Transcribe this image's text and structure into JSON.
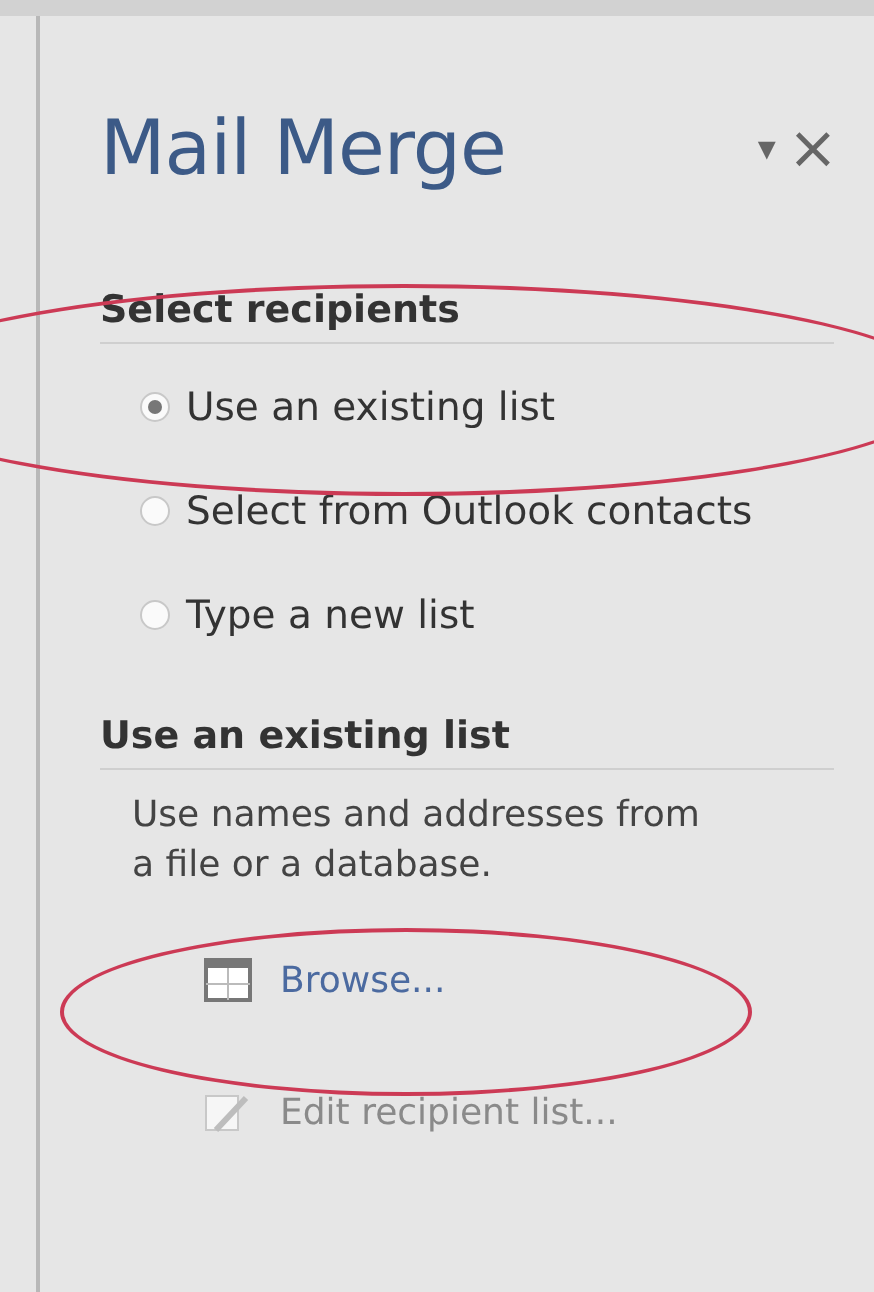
{
  "pane": {
    "title": "Mail Merge",
    "menu_glyph": "▾",
    "close_glyph": "×"
  },
  "select_recipients": {
    "heading": "Select recipients",
    "options": [
      {
        "label": "Use an existing list",
        "selected": true
      },
      {
        "label": "Select from Outlook contacts",
        "selected": false
      },
      {
        "label": "Type a new list",
        "selected": false
      }
    ]
  },
  "existing_list": {
    "heading": "Use an existing list",
    "description": "Use names and addresses from a file or a database.",
    "actions": [
      {
        "label": "Browse...",
        "kind": "browse",
        "disabled": false
      },
      {
        "label": "Edit recipient list...",
        "kind": "edit",
        "disabled": true
      }
    ]
  }
}
